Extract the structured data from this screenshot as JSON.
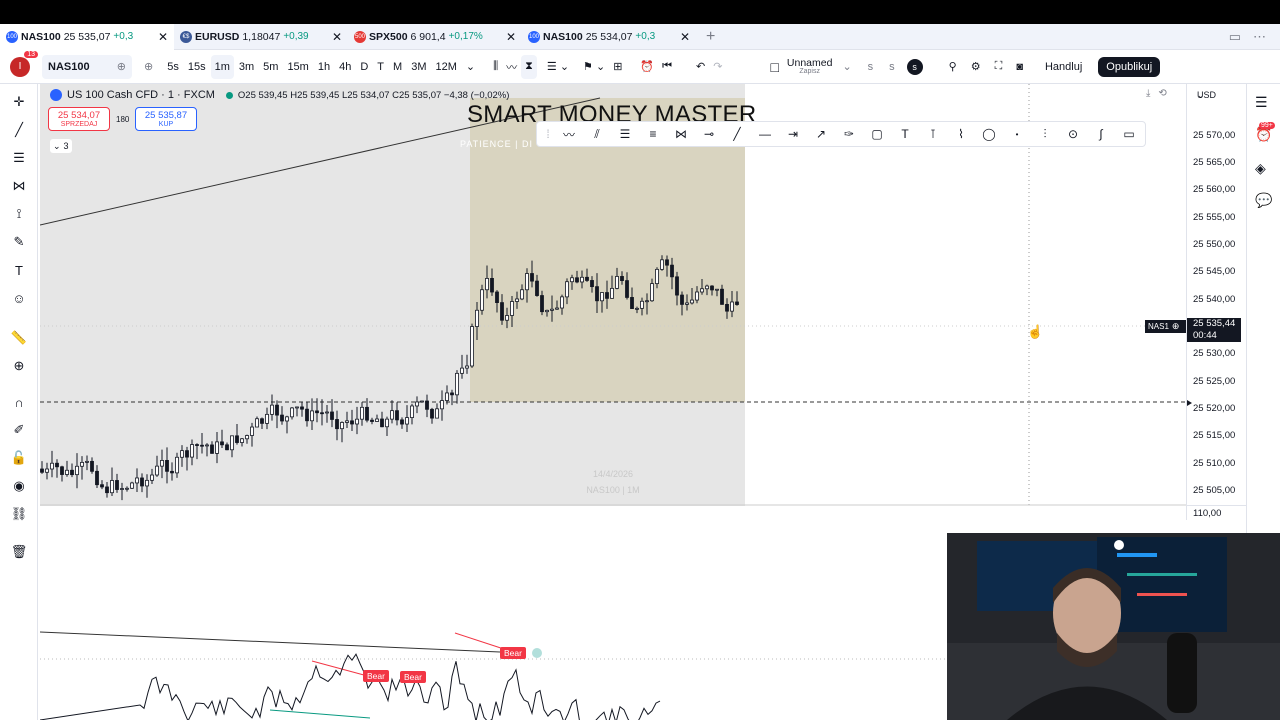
{
  "tabs": [
    {
      "symbol": "NAS100",
      "price": "25 535,07",
      "change": "+0,3",
      "icon_text": "100",
      "icon_color": "#2962ff",
      "active": true
    },
    {
      "symbol": "EURUSD",
      "price": "1,18047",
      "change": "+0,39",
      "icon_text": "€$",
      "icon_color": "#3b5998",
      "active": false
    },
    {
      "symbol": "SPX500",
      "price": "6 901,4",
      "change": "+0,17%",
      "icon_text": "500",
      "icon_color": "#e53935",
      "active": false
    },
    {
      "symbol": "NAS100",
      "price": "25 534,07",
      "change": "+0,3",
      "icon_text": "100",
      "icon_color": "#2962ff",
      "active": false
    }
  ],
  "toolbar": {
    "notifications": "13",
    "symbol": "NAS100",
    "intervals": [
      "5s",
      "15s",
      "1m",
      "3m",
      "5m",
      "15m",
      "1h",
      "4h",
      "D",
      "T",
      "M",
      "3M",
      "12M"
    ],
    "selected_interval": "1m",
    "layout_name": "Unnamed",
    "layout_sub": "Zapisz",
    "s1": "s",
    "s2": "s",
    "s3": "s",
    "trade_label": "Handluj",
    "publish_label": "Opublikuj"
  },
  "legend": {
    "title": "US 100 Cash CFD · 1 · FXCM",
    "ohlc": "O25 539,45  H25 539,45  L25 534,07  C25 535,07  −4,38 (−0,02%)",
    "sell_price": "25 534,07",
    "sell_label": "SPRZEDAJ",
    "spread": "180",
    "buy_price": "25 535,87",
    "buy_label": "KUP",
    "collapse_count": "3"
  },
  "overlay": {
    "title": "SMART MONEY MASTER",
    "subtitle": "PATIENCE  |  DI",
    "watermark_date": "14/4/2026",
    "watermark_symbol": "NAS100 | 1M"
  },
  "price_scale": {
    "currency": "USD",
    "ticks": [
      "25 570,00",
      "25 565,00",
      "25 560,00",
      "25 555,00",
      "25 550,00",
      "25 545,00",
      "25 540,00",
      "25 530,00",
      "25 525,00",
      "25 520,00",
      "25 515,00",
      "25 510,00",
      "25 505,00"
    ],
    "current_price": "25 535,44",
    "countdown": "00:44",
    "symbol_tag": "NAS1",
    "indicator_value": "110,00"
  },
  "indicator": {
    "labels": [
      "Bear",
      "Bear",
      "Bear"
    ]
  },
  "right_panel": {
    "badge": "99+"
  },
  "colors": {
    "accent": "#2962ff",
    "bull": "#089981",
    "bear": "#f23645",
    "zone": "#d8d2bd",
    "publish": "#131722"
  }
}
